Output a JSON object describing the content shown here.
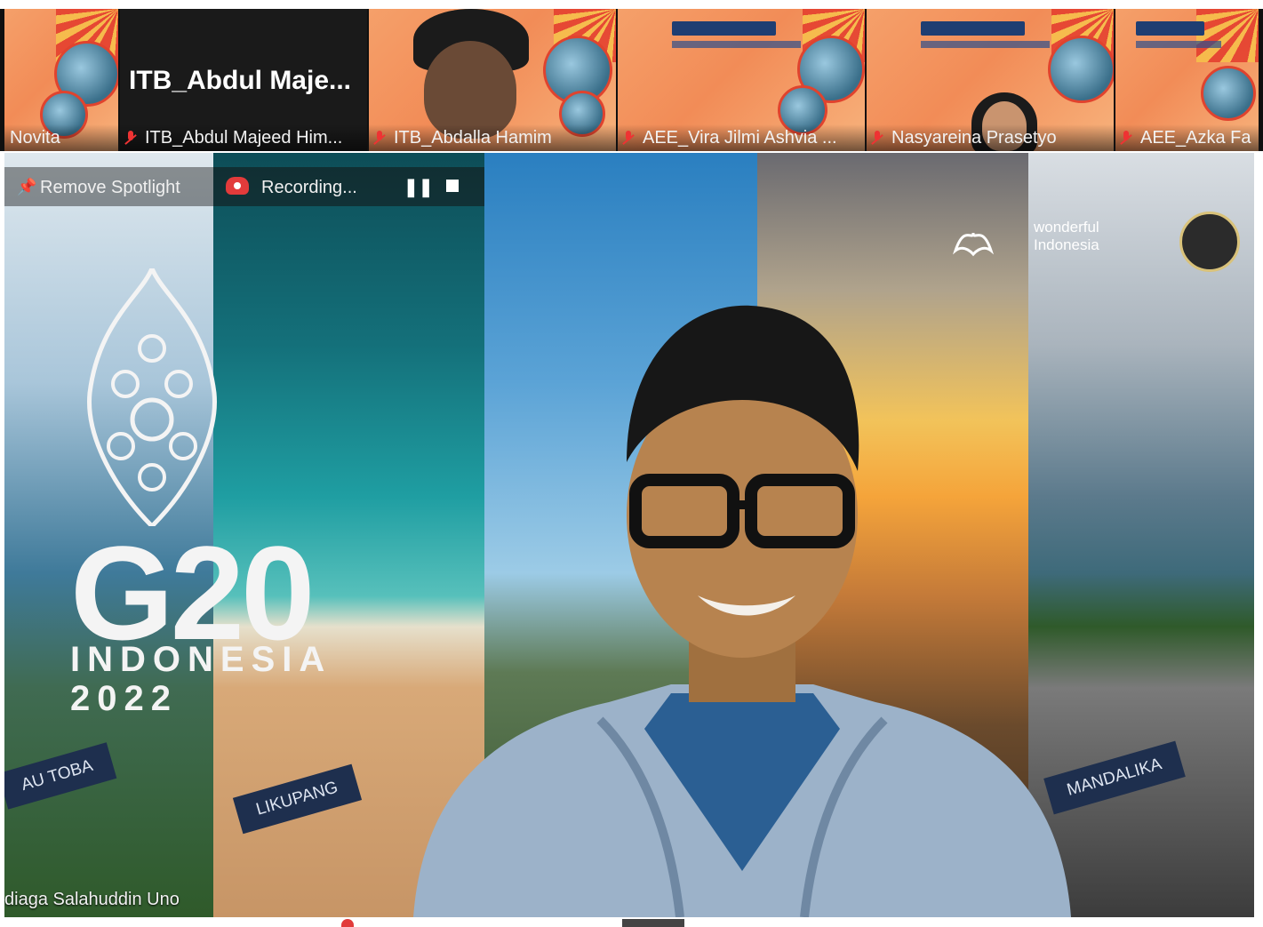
{
  "strip": {
    "tiles": [
      {
        "name": "Novita"
      },
      {
        "name": "ITB_Abdul Majeed Him...",
        "big_name": "ITB_Abdul  Maje..."
      },
      {
        "name": "ITB_Abdalla Hamim"
      },
      {
        "name": "AEE_Vira Jilmi Ashvia ..."
      },
      {
        "name": "Nasyareina Prasetyo"
      },
      {
        "name": "AEE_Azka Fa"
      }
    ]
  },
  "main": {
    "spotlight_label": "Remove Spotlight",
    "recording_label": "Recording...",
    "pause_glyph": "❚❚",
    "g20_text": "G20",
    "g20_country": "INDONESIA",
    "g20_year": "2022",
    "panel_tags": [
      "AU TOBA",
      "LIKUPANG",
      "MANDALIKA"
    ],
    "brand_text": "wonderful\nIndonesia",
    "speaker_caption": "diaga Salahuddin Uno"
  },
  "colors": {
    "recording": "#e23b3b",
    "muted_mic": "#ee3333",
    "tag_bg": "#1e2f4e"
  }
}
